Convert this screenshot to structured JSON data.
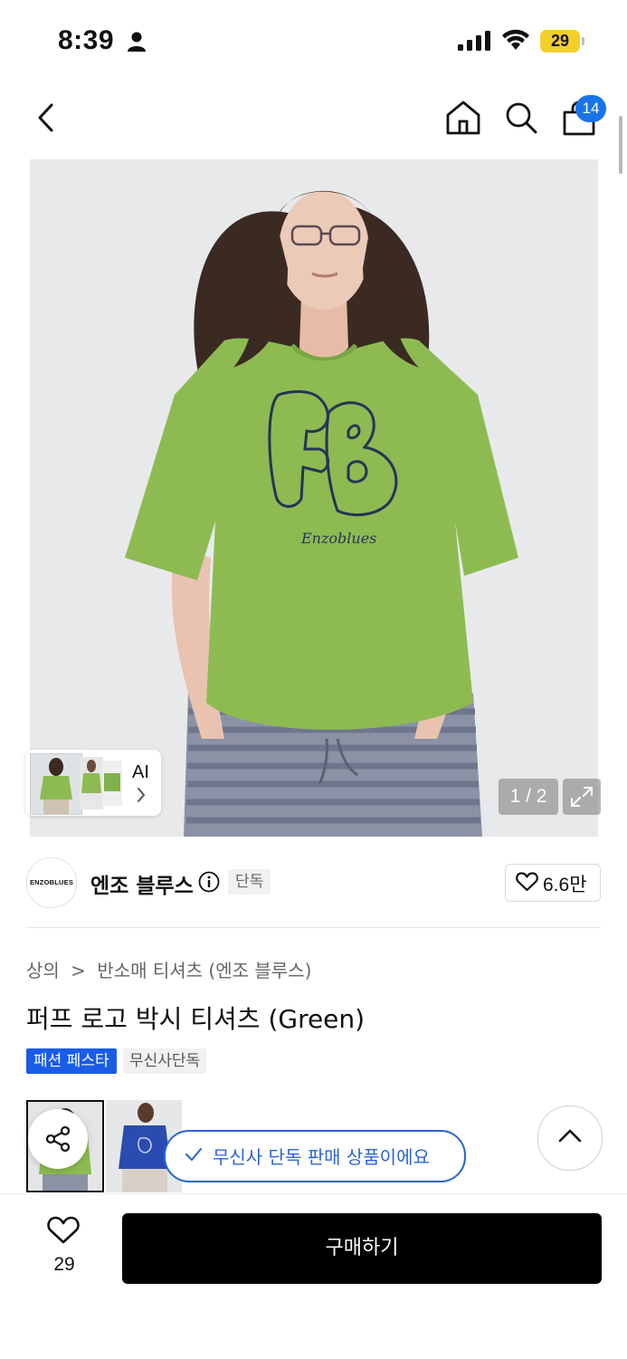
{
  "status_bar": {
    "time": "8:39",
    "battery": "29"
  },
  "nav": {
    "cart_count": "14"
  },
  "hero": {
    "counter": "1 / 2",
    "ai_label": "AI",
    "print_text": "Enzoblues"
  },
  "brand": {
    "logo_text": "ENZOBLUES",
    "name": "엔조 블루스",
    "exclusive_tag": "단독",
    "likes": "6.6만"
  },
  "breadcrumb": {
    "category": "상의",
    "separator": ">",
    "subcategory": "반소매 티셔츠 (엔조 블루스)"
  },
  "product": {
    "title": "퍼프 로고 박시 티셔츠 (Green)",
    "badges": [
      "패션 페스타",
      "무신사단독"
    ]
  },
  "exclusive_notice": "무신사 단독 판매 상품이에요",
  "bottom": {
    "like_count": "29",
    "buy_label": "구매하기"
  },
  "colors": {
    "accent_blue": "#1a5ce6",
    "tee_green": "#8dbb52",
    "badge_blue": "#1a73e8",
    "battery": "#f4cf2c"
  },
  "icons": [
    "person-icon",
    "signal-icon",
    "wifi-icon",
    "back-icon",
    "home-icon",
    "search-icon",
    "cart-icon",
    "expand-icon",
    "chevron-right-icon",
    "info-icon",
    "heart-icon",
    "share-icon",
    "check-icon",
    "chevron-up-icon"
  ]
}
